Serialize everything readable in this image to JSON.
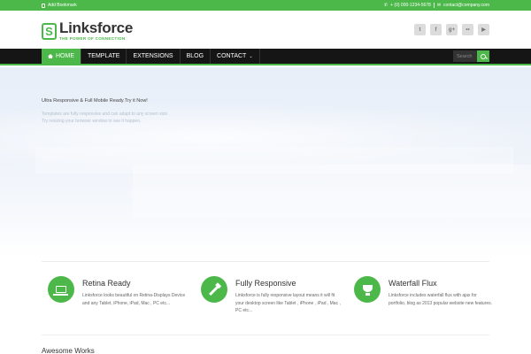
{
  "topbar": {
    "bookmark": "Add Bookmark",
    "phone": "+ (0) 000-1234-5678",
    "email": "contact@company.com"
  },
  "logo": {
    "mark": "S",
    "name": "Linksforce",
    "tagline": "THE POWER OF CONNECTION"
  },
  "social": [
    {
      "icon": "twitter-icon",
      "glyph": "t"
    },
    {
      "icon": "facebook-icon",
      "glyph": "f"
    },
    {
      "icon": "google-plus-icon",
      "glyph": "g+"
    },
    {
      "icon": "flickr-icon",
      "glyph": "••"
    },
    {
      "icon": "youtube-icon",
      "glyph": "▶"
    }
  ],
  "nav": {
    "items": [
      "HOME",
      "TEMPLATE",
      "EXTENSIONS",
      "BLOG",
      "CONTACT"
    ],
    "search_placeholder": "Search"
  },
  "hero": {
    "title": "Ultra Responsive & Full Mobile Ready.Try it Now!",
    "line1": "Templates are fully responsive and can adapt to any screen size.",
    "line2": "Try resizing your browser window to see it happen."
  },
  "features": [
    {
      "icon": "laptop-icon",
      "title": "Retina Ready",
      "desc": "Linksforce looks beautiful on Retina-Displays Device and any Tablet, iPhone, iPad, Mac , PC etc..."
    },
    {
      "icon": "magic-wand-icon",
      "title": "Fully Responsive",
      "desc": "Linksforce is fully responsive layout means it will fit your desktop screen like Tablet , iPhone , iPad , Mac , PC etc..."
    },
    {
      "icon": "trophy-icon",
      "title": "Waterfall Flux",
      "desc": "Linksforce includes waterfall flux with ajax for portfolio, blog as 2013 popular website new features."
    }
  ],
  "works_heading": "Awesome Works",
  "colors": {
    "accent": "#4cb84a",
    "nav_bg": "#151515"
  }
}
